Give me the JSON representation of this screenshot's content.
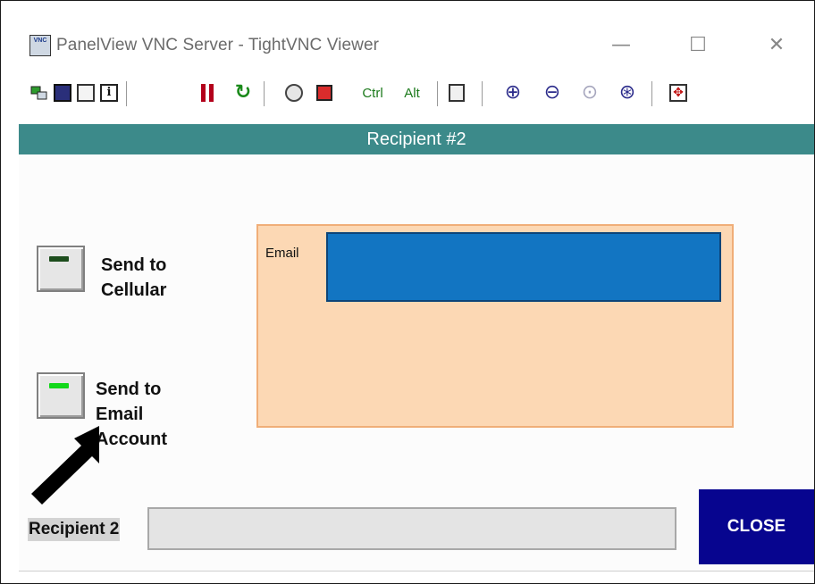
{
  "window": {
    "title": "PanelView VNC Server - TightVNC Viewer",
    "icon_text": "VNC",
    "minimize": "—",
    "maximize": "☐",
    "close": "✕"
  },
  "toolbar": {
    "ctrl_label": "Ctrl",
    "alt_label": "Alt",
    "icons": [
      "new-connection-icon",
      "save-icon",
      "properties-icon",
      "info-icon",
      "pause-icon",
      "refresh-icon",
      "options-icon",
      "connect-icon",
      "ctrl-key-icon",
      "alt-key-icon",
      "clipboard-icon",
      "zoom-in-icon",
      "zoom-out-icon",
      "zoom-100-icon",
      "zoom-auto-icon",
      "fullscreen-icon"
    ]
  },
  "screen": {
    "header": "Recipient #2",
    "send_cellular_label": "Send to\nCellular",
    "send_email_label": "Send to\nEmail\nAccount",
    "send_cellular_led": "off",
    "send_email_led": "on",
    "email_label": "Email",
    "email_value": "",
    "recipient_label": "Recipient 2",
    "recipient_value": "",
    "close_label": "CLOSE"
  },
  "colors": {
    "header_bg": "#3c8a8a",
    "email_panel_bg": "#fcd8b4",
    "email_field_bg": "#1275c2",
    "close_bg": "#07058f",
    "led_on": "#12d81a"
  }
}
